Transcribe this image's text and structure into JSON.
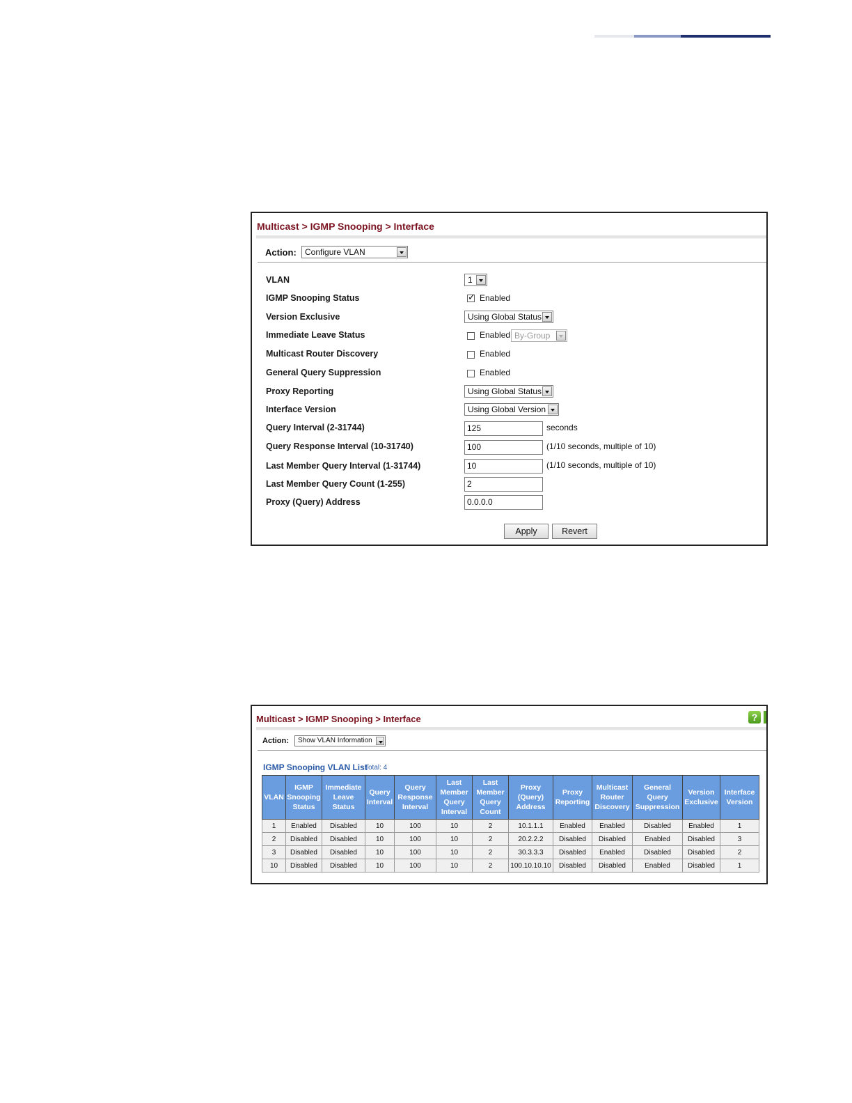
{
  "panel1": {
    "breadcrumb": "Multicast > IGMP Snooping > Interface",
    "action_label": "Action:",
    "action_value": "Configure VLAN",
    "fields": {
      "vlan": {
        "label": "VLAN",
        "value": "1"
      },
      "igmp_status": {
        "label": "IGMP Snooping Status",
        "checkbox_label": "Enabled",
        "checked": true
      },
      "version_exclusive": {
        "label": "Version Exclusive",
        "value": "Using Global Status"
      },
      "immediate_leave": {
        "label": "Immediate Leave Status",
        "checkbox_label": "Enabled",
        "checked": false,
        "mode_value": "By-Group"
      },
      "mrouter_discovery": {
        "label": "Multicast Router Discovery",
        "checkbox_label": "Enabled",
        "checked": false
      },
      "gq_suppression": {
        "label": "General Query Suppression",
        "checkbox_label": "Enabled",
        "checked": false
      },
      "proxy_reporting": {
        "label": "Proxy Reporting",
        "value": "Using Global Status"
      },
      "interface_version": {
        "label": "Interface Version",
        "value": "Using Global Version"
      },
      "query_interval": {
        "label": "Query Interval (2-31744)",
        "value": "125",
        "hint": "seconds"
      },
      "query_response_interval": {
        "label": "Query Response Interval (10-31740)",
        "value": "100",
        "hint": "(1/10 seconds, multiple of 10)"
      },
      "lmq_interval": {
        "label": "Last Member Query Interval (1-31744)",
        "value": "10",
        "hint": "(1/10 seconds, multiple of 10)"
      },
      "lmq_count": {
        "label": "Last Member Query Count (1-255)",
        "value": "2"
      },
      "proxy_address": {
        "label": "Proxy (Query) Address",
        "value": "0.0.0.0"
      }
    },
    "apply_label": "Apply",
    "revert_label": "Revert"
  },
  "panel2": {
    "breadcrumb": "Multicast > IGMP Snooping > Interface",
    "help_icon": "help-icon",
    "help_glyph": "?",
    "action_label": "Action:",
    "action_value": "Show VLAN Information",
    "list_title": "IGMP Snooping VLAN List",
    "total": "Total: 4",
    "columns": [
      "VLAN",
      "IGMP Snooping Status",
      "Immediate Leave Status",
      "Query Interval",
      "Query Response Interval",
      "Last Member Query Interval",
      "Last Member Query Count",
      "Proxy (Query) Address",
      "Proxy Reporting",
      "Multicast Router Discovery",
      "General Query Suppression",
      "Version Exclusive",
      "Interface Version"
    ],
    "rows": [
      [
        "1",
        "Enabled",
        "Disabled",
        "10",
        "100",
        "10",
        "2",
        "10.1.1.1",
        "Enabled",
        "Enabled",
        "Disabled",
        "Enabled",
        "1"
      ],
      [
        "2",
        "Disabled",
        "Disabled",
        "10",
        "100",
        "10",
        "2",
        "20.2.2.2",
        "Disabled",
        "Disabled",
        "Enabled",
        "Disabled",
        "3"
      ],
      [
        "3",
        "Disabled",
        "Disabled",
        "10",
        "100",
        "10",
        "2",
        "30.3.3.3",
        "Disabled",
        "Enabled",
        "Disabled",
        "Disabled",
        "2"
      ],
      [
        "10",
        "Disabled",
        "Disabled",
        "10",
        "100",
        "10",
        "2",
        "100.10.10.10",
        "Disabled",
        "Disabled",
        "Enabled",
        "Disabled",
        "1"
      ]
    ]
  },
  "colors": {
    "breadcrumb": "#7b1420",
    "table_header": "#6a9de0",
    "list_title": "#2a5aa8"
  }
}
